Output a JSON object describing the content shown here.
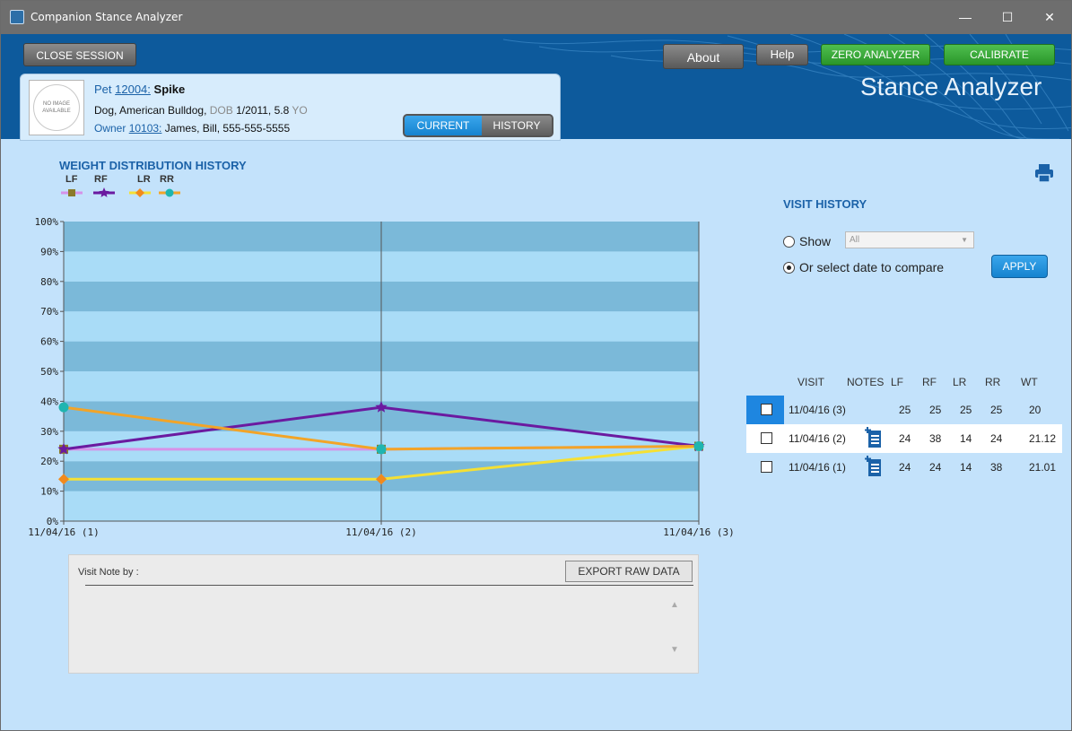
{
  "window": {
    "title": "Companion Stance Analyzer",
    "controls": {
      "minimize": "—",
      "maximize": "☐",
      "close": "✕"
    }
  },
  "header": {
    "close_session": "CLOSE SESSION",
    "about": "About",
    "help": "Help",
    "zero": "ZERO ANALYZER",
    "calibrate": "CALIBRATE",
    "brand": "Stance Analyzer"
  },
  "pet": {
    "photo_text": "NO IMAGE AVAILABLE",
    "pet_label": "Pet",
    "pet_id": "12004:",
    "pet_name": "Spike",
    "breed": "Dog, American Bulldog,",
    "dob_label": "DOB",
    "dob": "1/2011, 5.8",
    "yo_label": "YO",
    "owner_label": "Owner",
    "owner_id": "10103:",
    "owner": "James, Bill, 555-555-5555",
    "tab_current": "CURRENT",
    "tab_history": "HISTORY"
  },
  "chart_data": {
    "type": "line",
    "title": "WEIGHT DISTRIBUTION HISTORY",
    "categories": [
      "11/04/16 (1)",
      "11/04/16 (2)",
      "11/04/16 (3)"
    ],
    "y_ticks": [
      "0%",
      "10%",
      "20%",
      "30%",
      "40%",
      "50%",
      "60%",
      "70%",
      "80%",
      "90%",
      "100%"
    ],
    "ylim": [
      0,
      100
    ],
    "series": [
      {
        "name": "LF",
        "values": [
          24,
          24,
          25
        ],
        "color": "#d692e8",
        "marker": "square",
        "marker_color": "#8a7a2a"
      },
      {
        "name": "RF",
        "values": [
          24,
          38,
          25
        ],
        "color": "#6b1aa0",
        "marker": "star",
        "marker_color": "#6b1aa0"
      },
      {
        "name": "LR",
        "values": [
          14,
          14,
          25
        ],
        "color": "#f5e034",
        "marker": "diamond",
        "marker_color": "#f28a1c"
      },
      {
        "name": "RR",
        "values": [
          38,
          24,
          25
        ],
        "color": "#f2a428",
        "marker": "circle",
        "marker_color": "#1fb5b0"
      }
    ]
  },
  "notes": {
    "label": "Visit Note by :",
    "export": "EXPORT RAW DATA"
  },
  "visit_history": {
    "title": "VISIT HISTORY",
    "show_label": "Show",
    "show_value": "All",
    "compare_label": "Or select date to compare",
    "apply": "APPLY",
    "columns": [
      "VISIT",
      "NOTES",
      "LF",
      "RF",
      "LR",
      "RR",
      "WT"
    ],
    "rows": [
      {
        "visit": "11/04/16 (3)",
        "has_note": false,
        "lf": "25",
        "rf": "25",
        "lr": "25",
        "rr": "25",
        "wt": "20"
      },
      {
        "visit": "11/04/16 (2)",
        "has_note": true,
        "lf": "24",
        "rf": "38",
        "lr": "14",
        "rr": "24",
        "wt": "21.12"
      },
      {
        "visit": "11/04/16 (1)",
        "has_note": true,
        "lf": "24",
        "rf": "24",
        "lr": "14",
        "rr": "38",
        "wt": "21.01"
      }
    ]
  }
}
